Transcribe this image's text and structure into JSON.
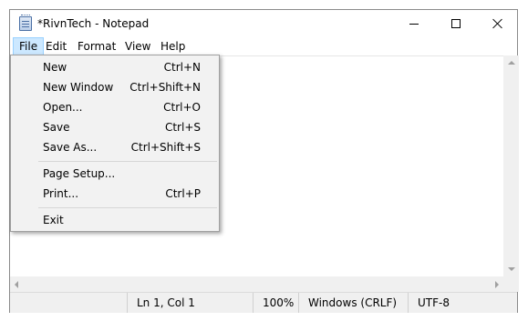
{
  "window": {
    "title": "*RivnTech - Notepad",
    "app_icon": "notepad-icon"
  },
  "controls": {
    "minimize_icon": "minimize-icon",
    "maximize_icon": "maximize-icon",
    "close_icon": "close-icon"
  },
  "menubar": {
    "items": [
      {
        "label": "File",
        "active": true
      },
      {
        "label": "Edit"
      },
      {
        "label": "Format"
      },
      {
        "label": "View"
      },
      {
        "label": "Help"
      }
    ]
  },
  "file_menu": {
    "items": [
      {
        "label": "New",
        "shortcut": "Ctrl+N"
      },
      {
        "label": "New Window",
        "shortcut": "Ctrl+Shift+N"
      },
      {
        "label": "Open...",
        "shortcut": "Ctrl+O"
      },
      {
        "label": "Save",
        "shortcut": "Ctrl+S"
      },
      {
        "label": "Save As...",
        "shortcut": "Ctrl+Shift+S"
      },
      {
        "label": "Page Setup...",
        "shortcut": ""
      },
      {
        "label": "Print...",
        "shortcut": "Ctrl+P"
      },
      {
        "label": "Exit",
        "shortcut": ""
      }
    ]
  },
  "editor": {
    "content": ""
  },
  "statusbar": {
    "position": "Ln 1, Col 1",
    "zoom": "100%",
    "line_ending": "Windows (CRLF)",
    "encoding": "UTF-8"
  },
  "colors": {
    "menu_highlight": "#cce8ff",
    "menu_highlight_border": "#99d1ff",
    "dropdown_bg": "#f2f2f2",
    "statusbar_bg": "#f0f0f0"
  }
}
